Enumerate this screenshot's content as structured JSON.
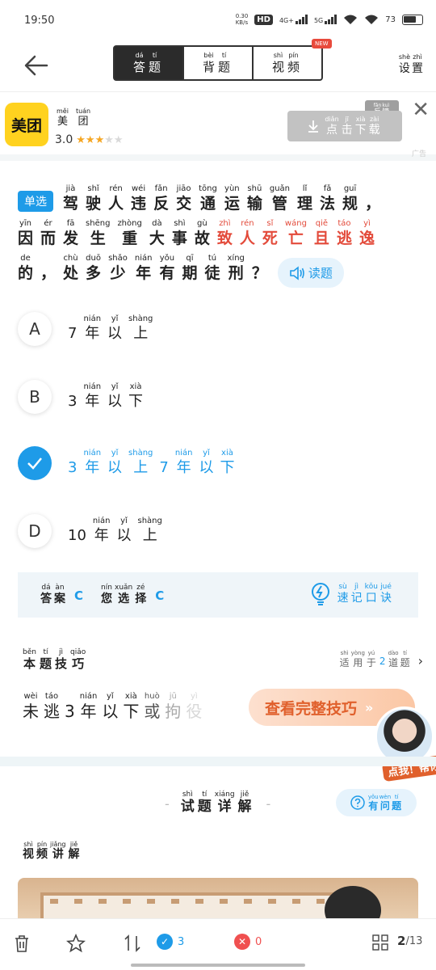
{
  "status": {
    "time": "19:50",
    "speed": "0.30\nKB/s",
    "battery": "73"
  },
  "nav": {
    "tabs": [
      {
        "chars": [
          [
            "答",
            "dá"
          ],
          [
            "题",
            "tí"
          ]
        ],
        "active": true
      },
      {
        "chars": [
          [
            "背",
            "bèi"
          ],
          [
            "题",
            "tí"
          ]
        ],
        "active": false
      },
      {
        "chars": [
          [
            "视",
            "shì"
          ],
          [
            "频",
            "pín"
          ]
        ],
        "active": false
      }
    ],
    "new_badge": "NEW",
    "settings": [
      [
        "设",
        "shè"
      ],
      [
        "置",
        "zhì"
      ]
    ]
  },
  "ad": {
    "logo_text": "美团",
    "brand": [
      [
        "美",
        "měi"
      ],
      [
        "团",
        "tuán"
      ]
    ],
    "rating": "3.0",
    "stars": 3,
    "download": [
      [
        "点",
        "diǎn"
      ],
      [
        "击",
        "jī"
      ],
      [
        "下",
        "xià"
      ],
      [
        "载",
        "zài"
      ]
    ],
    "feedback": [
      [
        "反",
        "fǎn"
      ],
      [
        "馈",
        "kuì"
      ]
    ],
    "ad_tag": "广告"
  },
  "question": {
    "type_label": "单选",
    "read_label": "读题",
    "lines": [
      [
        [
          "驾",
          "jià"
        ],
        [
          "驶",
          "shǐ"
        ],
        [
          "人",
          "rén"
        ],
        [
          "违",
          "wéi"
        ],
        [
          "反",
          "fǎn"
        ],
        [
          "交",
          "jiāo"
        ],
        [
          "通",
          "tōng"
        ],
        [
          "运",
          "yùn"
        ],
        [
          "输",
          "shū"
        ],
        [
          "管",
          "guǎn"
        ],
        [
          "理",
          "lǐ"
        ],
        [
          "法",
          "fǎ"
        ],
        [
          "规",
          "guī"
        ],
        [
          "，",
          ""
        ]
      ],
      [
        [
          "因",
          "yīn"
        ],
        [
          "而",
          "ér"
        ],
        [
          "发",
          "fā"
        ],
        [
          "生",
          "shēng"
        ],
        [
          "重",
          "zhòng"
        ],
        [
          "大",
          "dà"
        ],
        [
          "事",
          "shì"
        ],
        [
          "故",
          "gù"
        ],
        [
          "致",
          "zhì",
          "red"
        ],
        [
          "人",
          "rén",
          "red"
        ],
        [
          "死",
          "sǐ",
          "red"
        ],
        [
          "亡",
          "wáng",
          "red"
        ],
        [
          "且",
          "qiě",
          "red"
        ],
        [
          "逃",
          "táo",
          "red"
        ],
        [
          "逸",
          "yì",
          "red"
        ]
      ],
      [
        [
          "的",
          "de"
        ],
        [
          "，",
          ""
        ],
        [
          "处",
          "chù"
        ],
        [
          "多",
          "duō"
        ],
        [
          "少",
          "shǎo"
        ],
        [
          "年",
          "nián"
        ],
        [
          "有",
          "yǒu"
        ],
        [
          "期",
          "qī"
        ],
        [
          "徒",
          "tú"
        ],
        [
          "刑",
          "xíng"
        ],
        [
          "？",
          ""
        ]
      ]
    ]
  },
  "options": [
    {
      "letter": "A",
      "checked": false,
      "chars": [
        [
          "7",
          ""
        ],
        [
          "年",
          "nián"
        ],
        [
          "以",
          "yǐ"
        ],
        [
          "上",
          "shàng"
        ]
      ]
    },
    {
      "letter": "B",
      "checked": false,
      "chars": [
        [
          "3",
          ""
        ],
        [
          "年",
          "nián"
        ],
        [
          "以",
          "yǐ"
        ],
        [
          "下",
          "xià"
        ]
      ]
    },
    {
      "letter": "C",
      "checked": true,
      "chars": [
        [
          "3",
          ""
        ],
        [
          "年",
          "nián"
        ],
        [
          "以",
          "yǐ"
        ],
        [
          "上",
          "shàng"
        ],
        [
          "7",
          ""
        ],
        [
          "年",
          "nián"
        ],
        [
          "以",
          "yǐ"
        ],
        [
          "下",
          "xià"
        ]
      ]
    },
    {
      "letter": "D",
      "checked": false,
      "chars": [
        [
          "10",
          ""
        ],
        [
          "年",
          "nián"
        ],
        [
          "以",
          "yǐ"
        ],
        [
          "上",
          "shàng"
        ]
      ]
    }
  ],
  "answer": {
    "answer_label": [
      [
        "答",
        "dá"
      ],
      [
        "案",
        "àn"
      ]
    ],
    "answer_value": "C",
    "choice_label": [
      [
        "您",
        "nín"
      ],
      [
        "选",
        "xuǎn"
      ],
      [
        "择",
        "zé"
      ]
    ],
    "choice_value": "C",
    "memo": [
      [
        "速",
        "sù"
      ],
      [
        "记",
        "jì"
      ],
      [
        "口",
        "kǒu"
      ],
      [
        "诀",
        "jué"
      ]
    ]
  },
  "tips": {
    "heading": [
      [
        "本",
        "běn"
      ],
      [
        "题",
        "tí"
      ],
      [
        "技",
        "jì"
      ],
      [
        "巧",
        "qiǎo"
      ]
    ],
    "applies_pre": [
      [
        "适",
        "shì"
      ],
      [
        "用",
        "yòng"
      ],
      [
        "于",
        "yú"
      ]
    ],
    "applies_num": "2",
    "applies_post": [
      [
        "道",
        "dào"
      ],
      [
        "题",
        "tí"
      ]
    ],
    "line": [
      [
        "未",
        "wèi"
      ],
      [
        "逃",
        "táo"
      ],
      [
        "3",
        ""
      ],
      [
        "年",
        "nián"
      ],
      [
        "以",
        "yǐ"
      ],
      [
        "下",
        "xià"
      ],
      [
        "或",
        "huò"
      ],
      [
        "拘",
        "jū"
      ],
      [
        "役",
        "yì"
      ]
    ],
    "see_button": "查看完整技巧",
    "avatar_cta": "点我！帮你讲"
  },
  "detail": {
    "heading": [
      [
        "试",
        "shì"
      ],
      [
        "题",
        "tí"
      ],
      [
        "详",
        "xiáng"
      ],
      [
        "解",
        "jiě"
      ]
    ],
    "ask": [
      [
        "有",
        "yǒu"
      ],
      [
        "问",
        "wèn"
      ],
      [
        "题",
        "tí"
      ]
    ],
    "video_heading": [
      [
        "视",
        "shì"
      ],
      [
        "频",
        "pín"
      ],
      [
        "讲",
        "jiǎng"
      ],
      [
        "解",
        "jiě"
      ]
    ]
  },
  "bottom": {
    "correct_count": "3",
    "wrong_count": "0",
    "current": "2",
    "total": "/13"
  }
}
